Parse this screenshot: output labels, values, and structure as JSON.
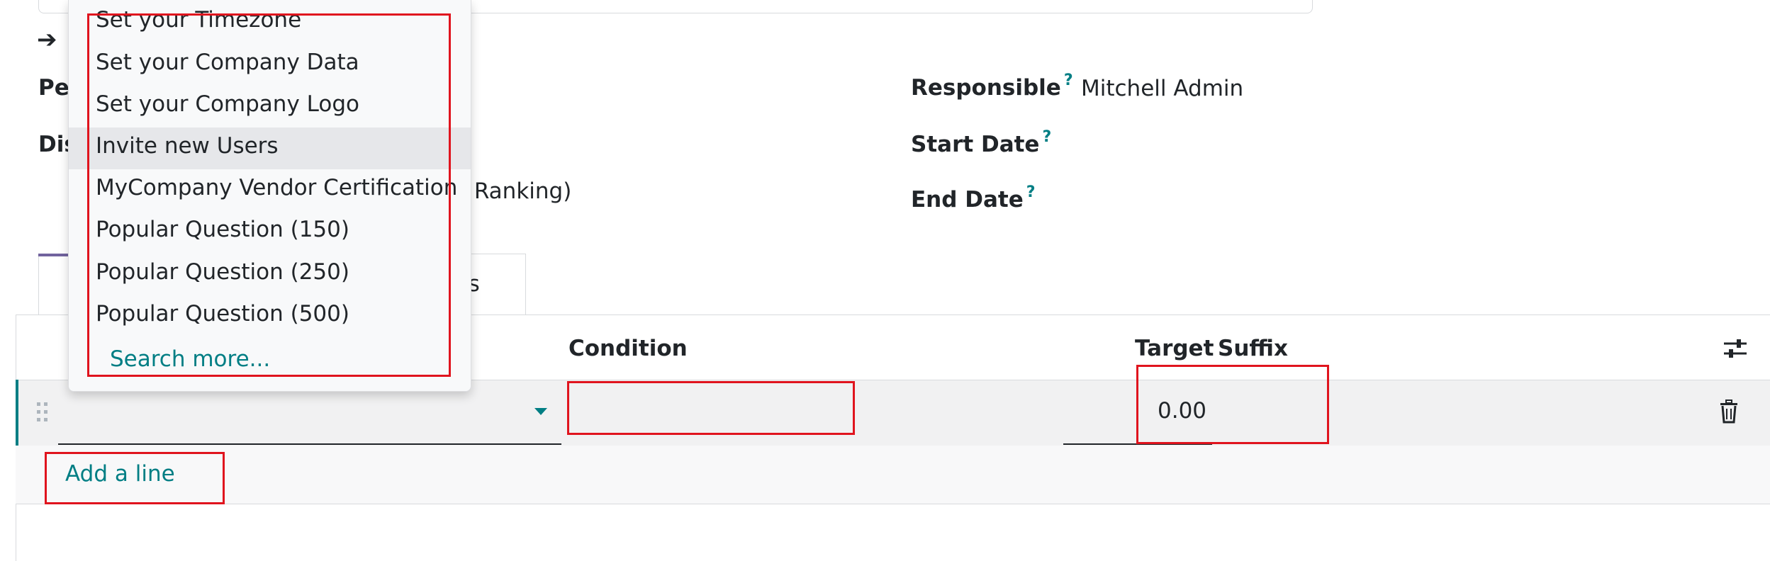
{
  "form": {
    "partial_label_1": "Pe",
    "partial_label_2": "Dis",
    "partial_value_ranking": "o Ranking)",
    "responsible_label": "Responsible",
    "responsible_value": "Mitchell Admin",
    "start_date_label": "Start Date",
    "end_date_label": "End Date",
    "help_mark": "?",
    "arrow": "➔"
  },
  "tabs": {
    "second_tab_partial": "ons"
  },
  "list": {
    "columns": {
      "condition": "Condition",
      "target": "Target",
      "suffix": "Suffix"
    },
    "row": {
      "target_value": "0.00"
    },
    "add_line": "Add a line"
  },
  "dropdown": {
    "items": [
      "Set your Timezone",
      "Set your Company Data",
      "Set your Company Logo",
      "Invite new Users",
      "MyCompany Vendor Certification",
      "Popular Question (150)",
      "Popular Question (250)",
      "Popular Question (500)"
    ],
    "active_index": 3,
    "search_more": "Search more..."
  },
  "colors": {
    "accent": "#017e84",
    "annotation_red": "#e0141e",
    "tab_active": "#71639e"
  }
}
